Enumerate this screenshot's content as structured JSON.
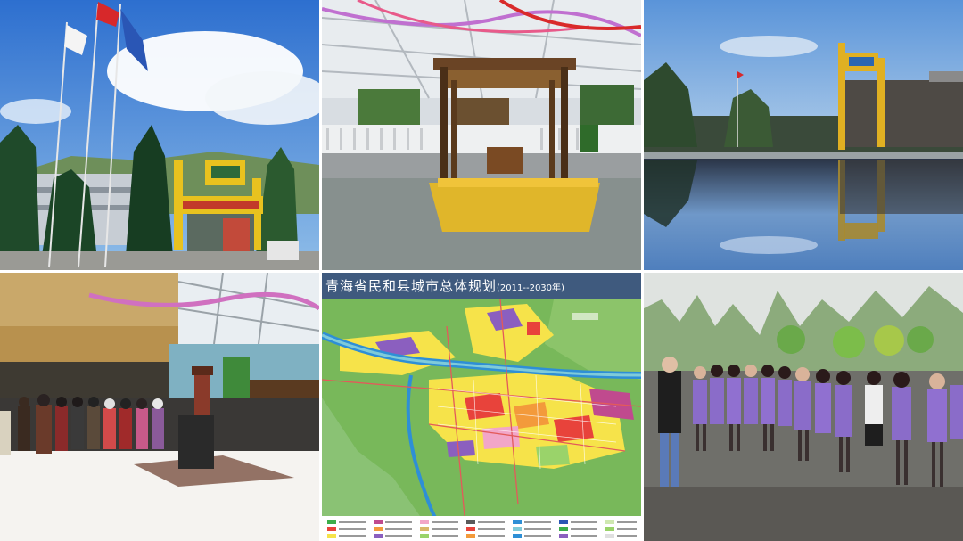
{
  "collage": {
    "tiles": [
      {
        "id": "flag-plaza"
      },
      {
        "id": "greenhouse-boat"
      },
      {
        "id": "reflection-gate"
      },
      {
        "id": "lobby"
      },
      {
        "id": "city-plan-map"
      },
      {
        "id": "staff-lineup"
      }
    ]
  },
  "map": {
    "title": "青海省民和县城市总体规划",
    "years": "(2011--2030年)",
    "legend_colors": [
      "#e8433b",
      "#f39a3b",
      "#f6e34a",
      "#8b5fbf",
      "#3cae4a",
      "#2e8fd6",
      "#f2a6c8",
      "#9ad36a",
      "#c04a8e",
      "#7fcbd9",
      "#5a5a5a",
      "#d9b76a"
    ]
  },
  "colors": {
    "sky_blue": "#3d7fd1",
    "gate_yellow": "#e8c21f",
    "uniform_purple": "#8a6cc9",
    "map_bg": "#7bbf5a",
    "title_bar": "#3f5a7e"
  }
}
